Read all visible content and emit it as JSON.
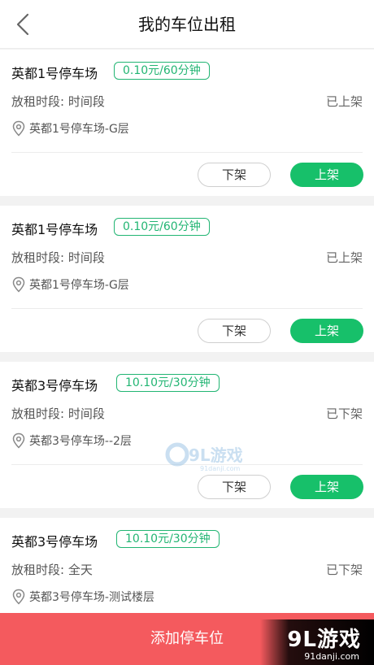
{
  "header": {
    "title": "我的车位出租"
  },
  "cards": [
    {
      "name": "英都1号停车场",
      "rate": "0.10元/60分钟",
      "period": "放租时段: 时间段",
      "status": "已上架",
      "location": "英都1号停车场-G层",
      "off_label": "下架",
      "on_label": "上架"
    },
    {
      "name": "英都1号停车场",
      "rate": "0.10元/60分钟",
      "period": "放租时段: 时间段",
      "status": "已上架",
      "location": "英都1号停车场-G层",
      "off_label": "下架",
      "on_label": "上架"
    },
    {
      "name": "英都3号停车场",
      "rate": "10.10元/30分钟",
      "period": "放租时段: 时间段",
      "status": "已下架",
      "location": "英都3号停车场--2层",
      "off_label": "下架",
      "on_label": "上架"
    },
    {
      "name": "英都3号停车场",
      "rate": "10.10元/30分钟",
      "period": "放租时段: 全天",
      "status": "已下架",
      "location": "英都3号停车场-测试楼层"
    }
  ],
  "footer": {
    "add_label": "添加停车位"
  },
  "watermark": {
    "logo": "9L游戏",
    "url": "91danji.com",
    "small_logo": "9L游戏",
    "small_url": "91danji.com"
  },
  "colors": {
    "accent_green": "#17c06a",
    "badge_green": "#22b573",
    "add_red": "#f45a5e"
  }
}
